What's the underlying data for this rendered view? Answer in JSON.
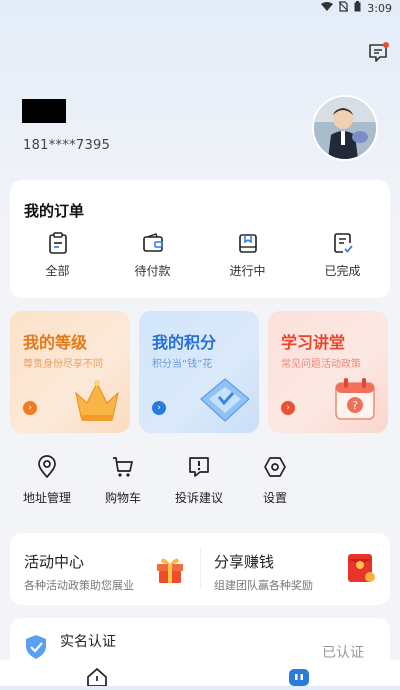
{
  "status_bar": {
    "time": "3:09",
    "icons": [
      "wifi-icon",
      "no-sim-icon",
      "battery-icon"
    ]
  },
  "profile": {
    "phone": "181****7395"
  },
  "orders": {
    "title": "我的订单",
    "items": [
      {
        "label": "全部",
        "icon": "clipboard-icon"
      },
      {
        "label": "待付款",
        "icon": "wallet-icon"
      },
      {
        "label": "进行中",
        "icon": "bookmark-box-icon"
      },
      {
        "label": "已完成",
        "icon": "checklist-icon"
      }
    ]
  },
  "promos": [
    {
      "title": "我的等级",
      "subtitle": "尊贵身份尽享不同",
      "icon": "crown-icon"
    },
    {
      "title": "我的积分",
      "subtitle": "积分当“钱”花",
      "icon": "points-diamond-icon"
    },
    {
      "title": "学习讲堂",
      "subtitle": "常见问题活动政策",
      "icon": "calendar-question-icon"
    }
  ],
  "tools": [
    {
      "label": "地址管理",
      "icon": "location-pin-icon"
    },
    {
      "label": "购物车",
      "icon": "cart-icon"
    },
    {
      "label": "投诉建议",
      "icon": "feedback-icon"
    },
    {
      "label": "设置",
      "icon": "settings-hex-icon"
    }
  ],
  "activity": {
    "left": {
      "title": "活动中心",
      "subtitle": "各种活动政策助您展业",
      "icon": "gift-icon"
    },
    "right": {
      "title": "分享赚钱",
      "subtitle": "组建团队赢各种奖励",
      "icon": "red-envelope-icon"
    }
  },
  "verification": {
    "title": "实名认证",
    "status": "已认证",
    "icon": "shield-check-icon"
  },
  "colors": {
    "orange": "#f07b22",
    "blue": "#2a7ae0",
    "red": "#ea5234"
  }
}
